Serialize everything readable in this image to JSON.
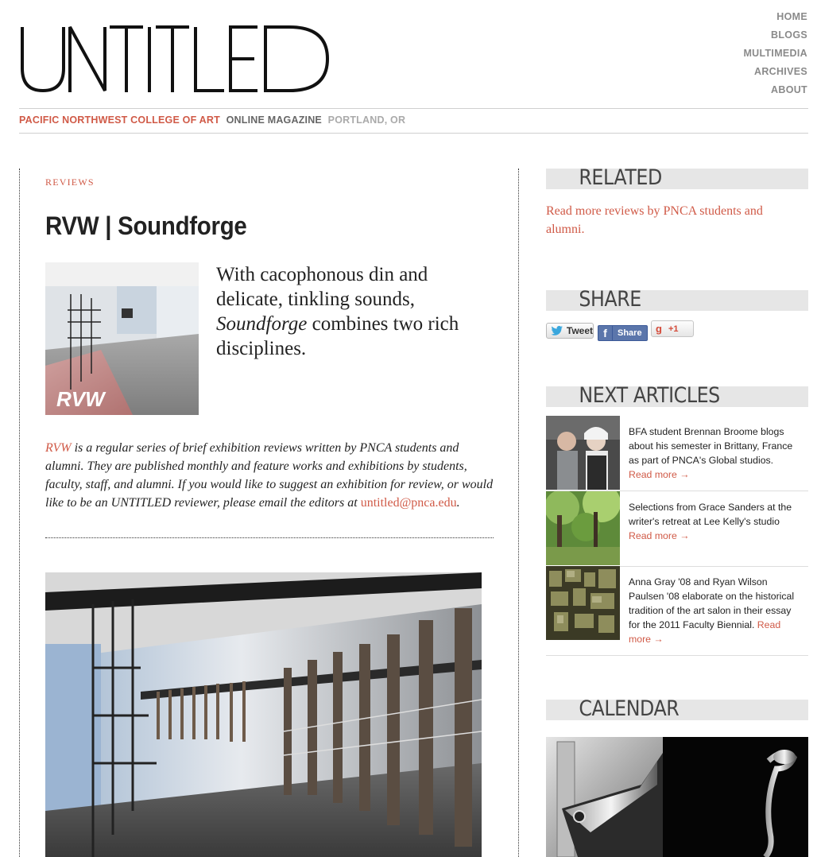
{
  "site": {
    "logo_text": "UNTITLED",
    "nav": [
      "HOME",
      "BLOGS",
      "MULTIMEDIA",
      "ARCHIVES",
      "ABOUT"
    ],
    "tagline": {
      "school": "PACIFIC NORTHWEST COLLEGE OF ART",
      "magazine": "ONLINE MAGAZINE",
      "city": "PORTLAND, OR"
    }
  },
  "article": {
    "kicker": "REVIEWS",
    "title": "RVW | Soundforge",
    "thumb_label": "RVW",
    "deck_before": "With cacophonous din and delicate, tinkling sounds,",
    "deck_em": "Soundforge",
    "deck_after": "combines two rich disciplines.",
    "intro_link": "RVW",
    "intro_text": "is a regular series of brief exhibition reviews written by PNCA students and alumni. They are published monthly and feature works and exhibitions by students, faculty, staff, and alumni. If you would like to suggest an exhibition for review, or would like to be an UNTITLED reviewer, please email the editors at",
    "intro_email": "untitled@pnca.edu",
    "intro_end": "."
  },
  "sidebar": {
    "related_heading": "RELATED",
    "related_link": "Read more reviews by PNCA students and alumni.",
    "share_heading": "SHARE",
    "share_buttons": {
      "tweet": "Tweet",
      "facebook": "Share",
      "gplus": "+1"
    },
    "next_heading": "NEXT ARTICLES",
    "next_articles": [
      {
        "text": "BFA student Brennan Broome blogs about his semester in Brittany, France as part of PNCA's Global studios.",
        "more": "Read more →"
      },
      {
        "text": "Selections from Grace Sanders at the writer's retreat at Lee Kelly's studio",
        "more": "Read more →"
      },
      {
        "text": "Anna Gray '08 and Ryan Wilson Paulsen '08 elaborate on the historical tradition of the art salon in their essay for the 2011 Faculty Biennial.",
        "more": "Read more →"
      }
    ],
    "calendar_heading": "CALENDAR"
  },
  "colors": {
    "accent": "#d05a47",
    "nav_gray": "#8a8a8a",
    "section_bar": "#e6e6e6"
  },
  "icons": [
    "twitter-bird-icon",
    "facebook-icon",
    "google-g-icon",
    "arrow-right-icon"
  ]
}
